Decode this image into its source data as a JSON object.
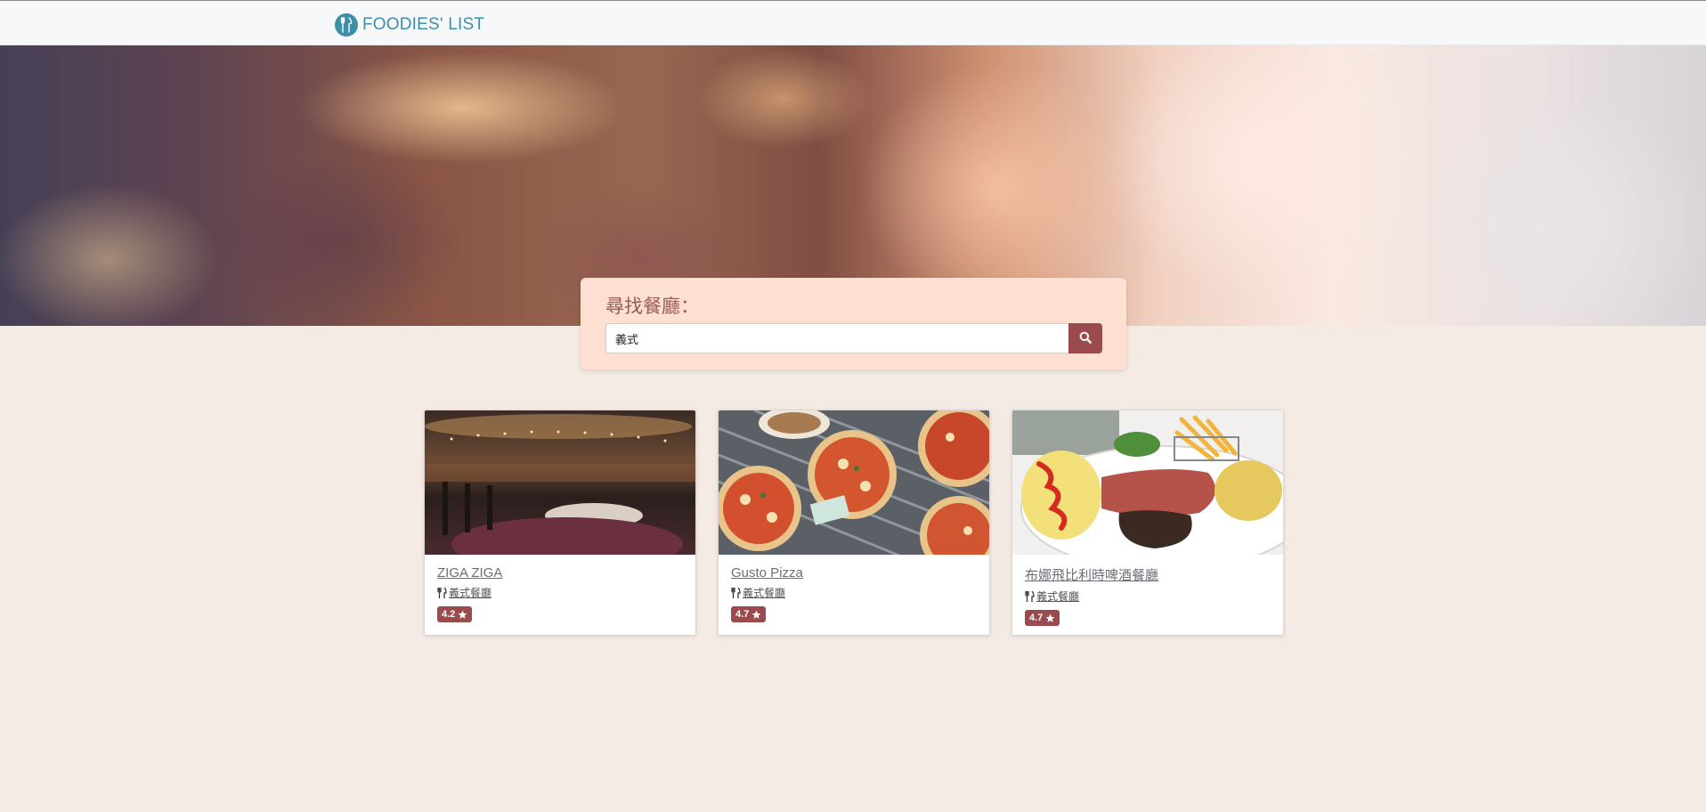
{
  "nav": {
    "brand": "FOODIES' LIST",
    "brand_icon": "fork-knife-icon"
  },
  "search": {
    "title": "尋找餐廳：",
    "value": "義式",
    "button_icon": "search-icon"
  },
  "restaurants": [
    {
      "name": "ZIGA ZIGA",
      "category": "義式餐廳",
      "rating": "4.2",
      "image": "restaurant-interior"
    },
    {
      "name": "Gusto Pizza",
      "category": "義式餐廳",
      "rating": "4.7",
      "image": "pizza-table"
    },
    {
      "name": "布娜飛比利時啤酒餐廳",
      "category": "義式餐廳",
      "rating": "4.7",
      "image": "sausage-omelette-plate"
    }
  ],
  "colors": {
    "brand": "#3d8ea8",
    "accent": "#9b4a4d",
    "page_bg": "#f4ebe5",
    "panel_bg": "#fde0d1"
  }
}
